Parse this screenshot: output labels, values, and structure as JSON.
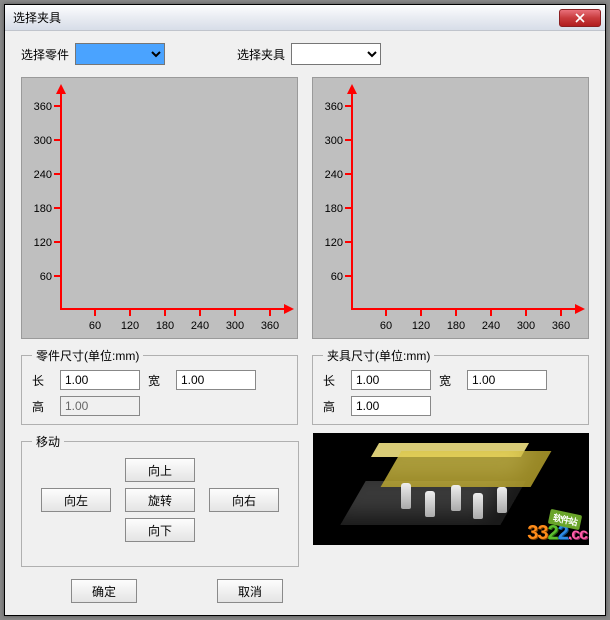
{
  "window": {
    "title": "选择夹具"
  },
  "selectors": {
    "part_label": "选择零件",
    "fixture_label": "选择夹具",
    "part_value": "",
    "fixture_value": ""
  },
  "axis_ticks": [
    "60",
    "120",
    "180",
    "240",
    "300",
    "360"
  ],
  "dims_part": {
    "legend": "零件尺寸(单位:mm)",
    "length_label": "长",
    "length_value": "1.00",
    "width_label": "宽",
    "width_value": "1.00",
    "height_label": "高",
    "height_value": "1.00"
  },
  "dims_fixture": {
    "legend": "夹具尺寸(单位:mm)",
    "length_label": "长",
    "length_value": "1.00",
    "width_label": "宽",
    "width_value": "1.00",
    "height_label": "高",
    "height_value": "1.00"
  },
  "move": {
    "legend": "移动",
    "up": "向上",
    "left": "向左",
    "rotate": "旋转",
    "right": "向右",
    "down": "向下"
  },
  "actions": {
    "ok": "确定",
    "cancel": "取消"
  },
  "watermark": {
    "d3": "3",
    "d2a": "2",
    "d2b": "2",
    "cc": ".cc",
    "tag": "软件站"
  },
  "chart_data": [
    {
      "type": "scatter",
      "title": "零件",
      "x": [],
      "y": [],
      "xlim": [
        0,
        360
      ],
      "ylim": [
        0,
        360
      ],
      "xticks": [
        60,
        120,
        180,
        240,
        300,
        360
      ],
      "yticks": [
        60,
        120,
        180,
        240,
        300,
        360
      ]
    },
    {
      "type": "scatter",
      "title": "夹具",
      "x": [],
      "y": [],
      "xlim": [
        0,
        360
      ],
      "ylim": [
        0,
        360
      ],
      "xticks": [
        60,
        120,
        180,
        240,
        300,
        360
      ],
      "yticks": [
        60,
        120,
        180,
        240,
        300,
        360
      ]
    }
  ]
}
